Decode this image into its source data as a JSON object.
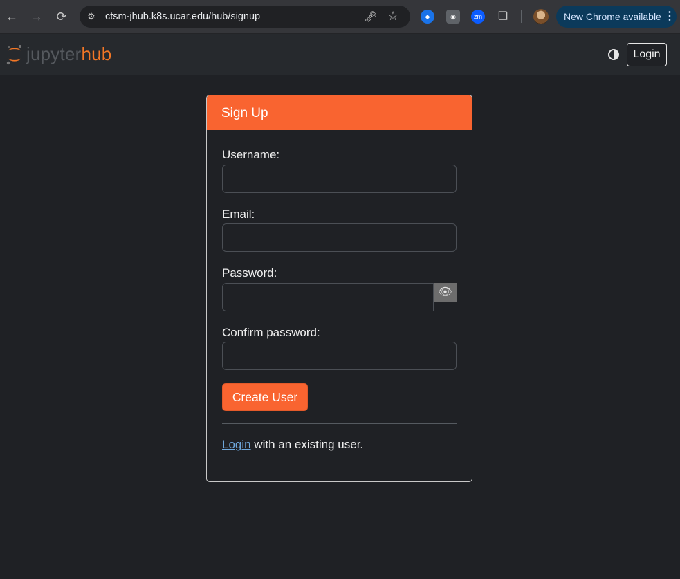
{
  "browser": {
    "url": "ctsm-jhub.k8s.ucar.edu/hub/signup",
    "update_label": "New Chrome available",
    "icons": [
      "back-icon",
      "forward-icon",
      "reload-icon",
      "site-settings-icon",
      "password-key-icon",
      "bookmark-star-icon",
      "extension-icon",
      "camera-icon",
      "zoom-extension-icon",
      "puzzle-icon",
      "profile-avatar",
      "more-vert-icon"
    ]
  },
  "header": {
    "logo_jupyter": "jupyter",
    "logo_hub": "hub",
    "login_label": "Login"
  },
  "signup": {
    "title": "Sign Up",
    "username_label": "Username:",
    "email_label": "Email:",
    "password_label": "Password:",
    "confirm_label": "Confirm password:",
    "create_label": "Create User",
    "login_link": "Login",
    "login_suffix": " with an existing user."
  },
  "colors": {
    "accent": "#f96430",
    "background": "#1f2125",
    "header": "#26292d",
    "link": "#6fa8dc"
  }
}
